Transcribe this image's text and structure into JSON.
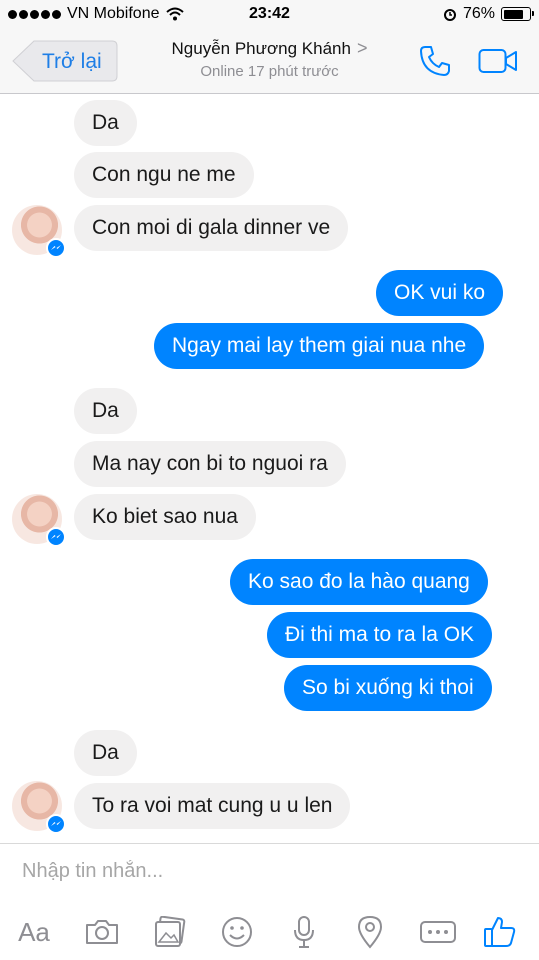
{
  "status_bar": {
    "carrier": "VN Mobifone",
    "time": "23:42",
    "battery": "76%",
    "battery_level": 0.76
  },
  "nav": {
    "back_label": "Trở lại",
    "contact_name": "Nguyễn Phương Khánh",
    "chevron": ">",
    "contact_status": "Online 17 phút trước"
  },
  "messages": [
    {
      "sender": "them",
      "text": "Da"
    },
    {
      "sender": "them",
      "text": "Con ngu ne me"
    },
    {
      "sender": "them",
      "text": "Con moi di gala dinner ve"
    },
    {
      "sender": "me",
      "text": "OK vui ko"
    },
    {
      "sender": "me",
      "text": "Ngay mai lay them giai nua nhe"
    },
    {
      "sender": "them",
      "text": "Da"
    },
    {
      "sender": "them",
      "text": "Ma nay con bi to nguoi ra"
    },
    {
      "sender": "them",
      "text": "Ko biet sao nua"
    },
    {
      "sender": "me",
      "text": "Ko sao đo la hào quang"
    },
    {
      "sender": "me",
      "text": "Đi thi ma to ra la OK"
    },
    {
      "sender": "me",
      "text": "So bi xuống ki thoi"
    },
    {
      "sender": "them",
      "text": "Da"
    },
    {
      "sender": "them",
      "text": "To ra voi mat cung u u len"
    }
  ],
  "composer": {
    "placeholder": "Nhập tin nhắn..."
  },
  "toolbar": {
    "aa_label": "Aa",
    "icons": [
      "text-format",
      "camera",
      "photos",
      "emoji",
      "microphone",
      "location",
      "more",
      "like"
    ]
  },
  "colors": {
    "accent": "#0084ff",
    "link": "#1e7ee6",
    "incoming_bubble": "#f1f0f0",
    "nav_background": "#f7f7f7"
  }
}
